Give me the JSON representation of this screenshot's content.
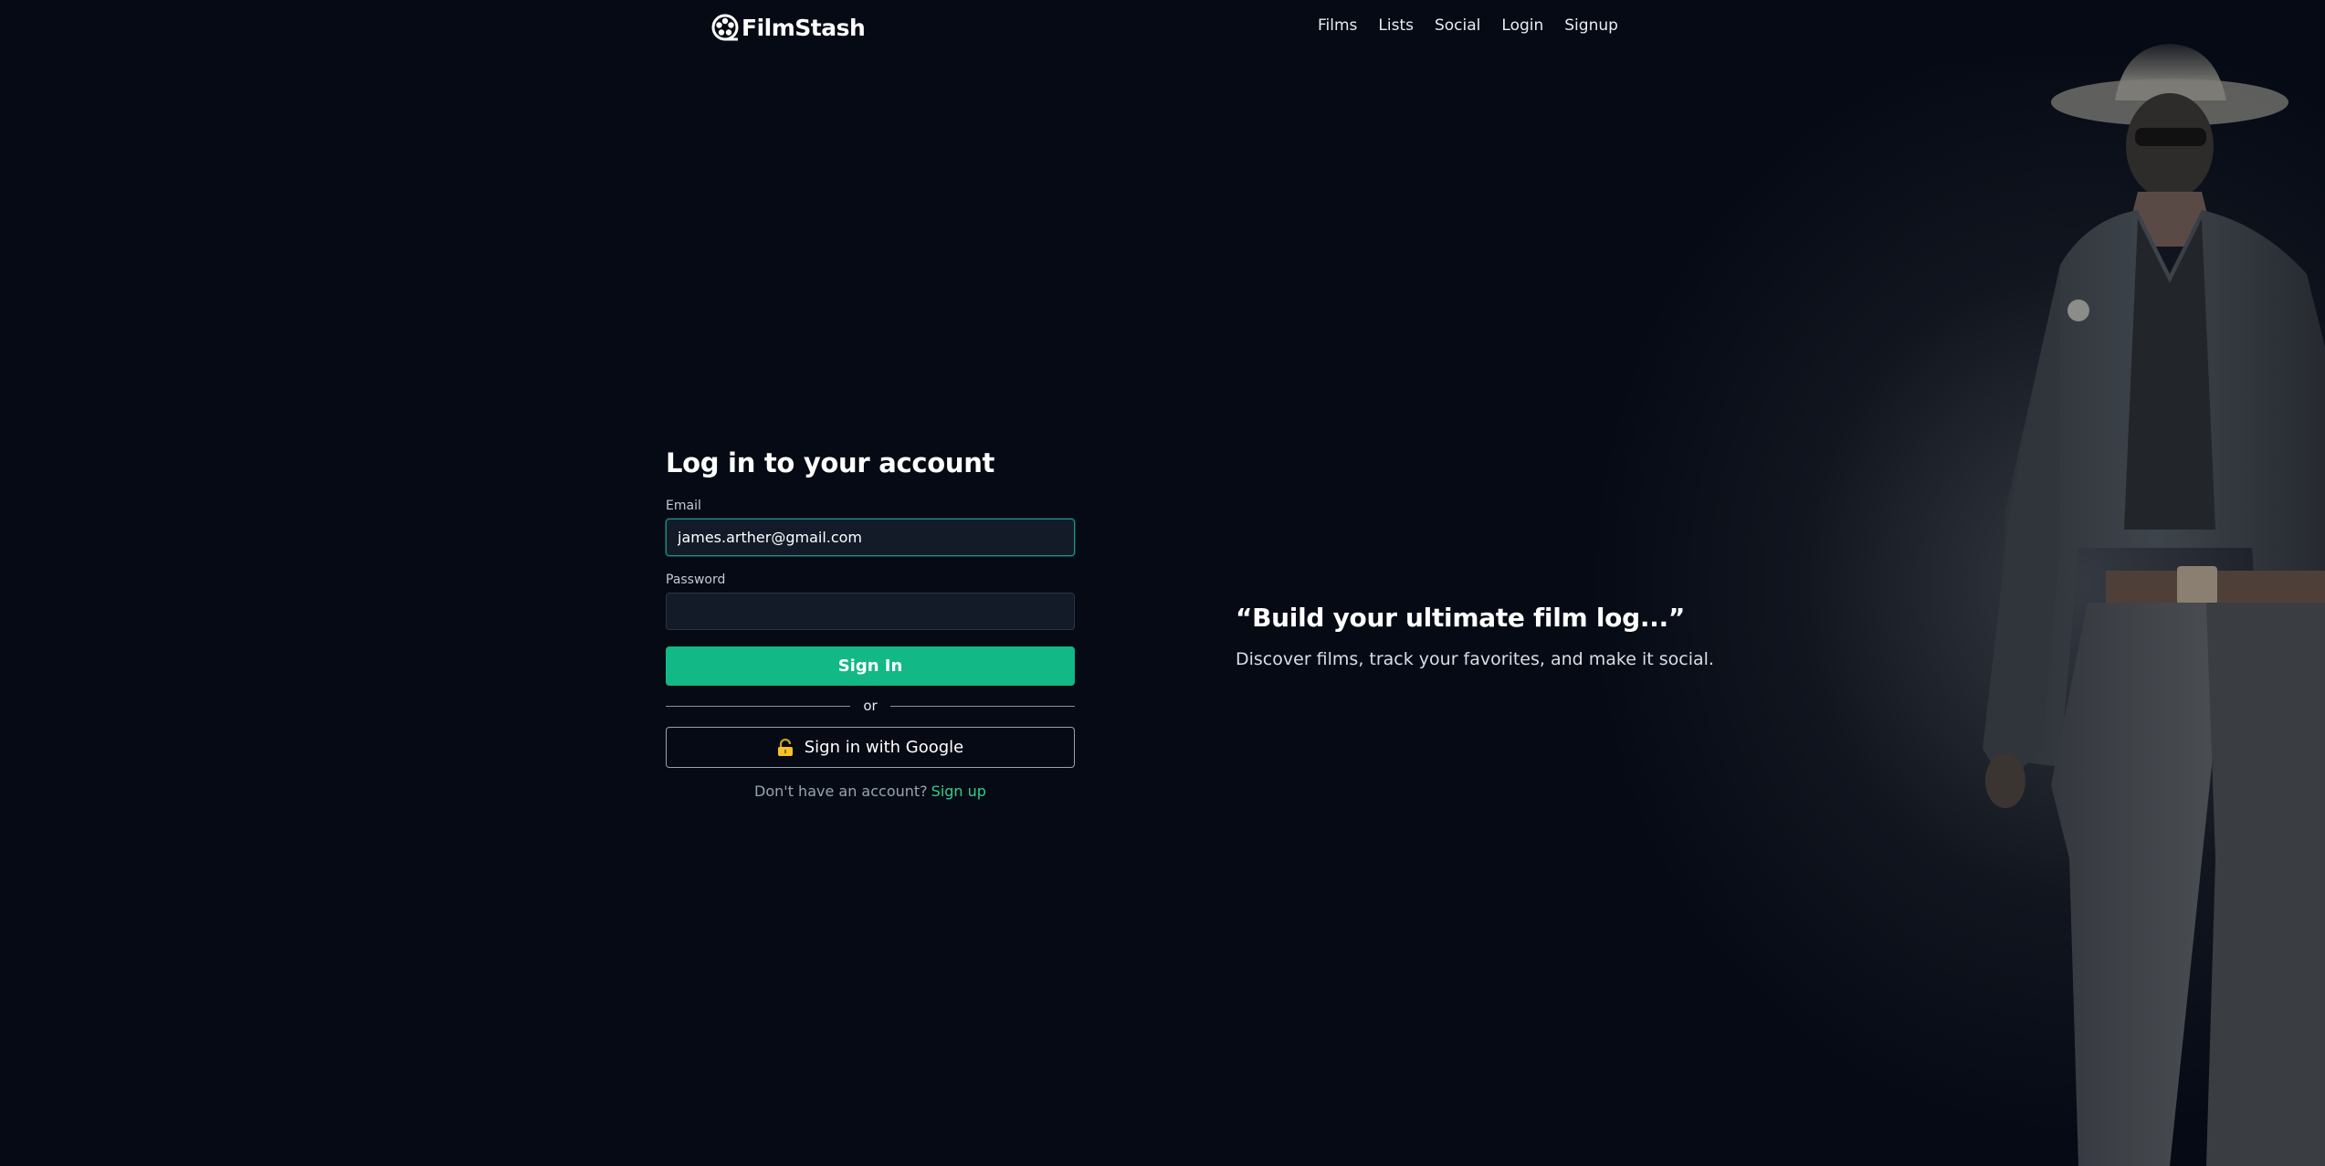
{
  "nav": {
    "logo_text": "FilmStash",
    "logo_icon": "film-reel-icon",
    "links": [
      {
        "label": "Films"
      },
      {
        "label": "Lists"
      },
      {
        "label": "Social"
      },
      {
        "label": "Login"
      },
      {
        "label": "Signup"
      }
    ]
  },
  "login": {
    "title": "Log in to your account",
    "email_label": "Email",
    "email_value": "james.arther@gmail.com",
    "password_label": "Password",
    "password_value": "",
    "signin_label": "Sign In",
    "divider_text": "or",
    "google_label": "Sign in with Google",
    "google_icon": "lock-icon",
    "no_account_text": "Don't have an account?",
    "signup_link": "Sign up"
  },
  "hero": {
    "quote": "“Build your ultimate film log...”",
    "subtitle": "Discover films, track your favorites, and make it social."
  },
  "colors": {
    "background": "#050a14",
    "accent": "#12b886",
    "link_green": "#2fd08f",
    "input_bg": "#131b29",
    "focus_border": "#1f8f86"
  }
}
